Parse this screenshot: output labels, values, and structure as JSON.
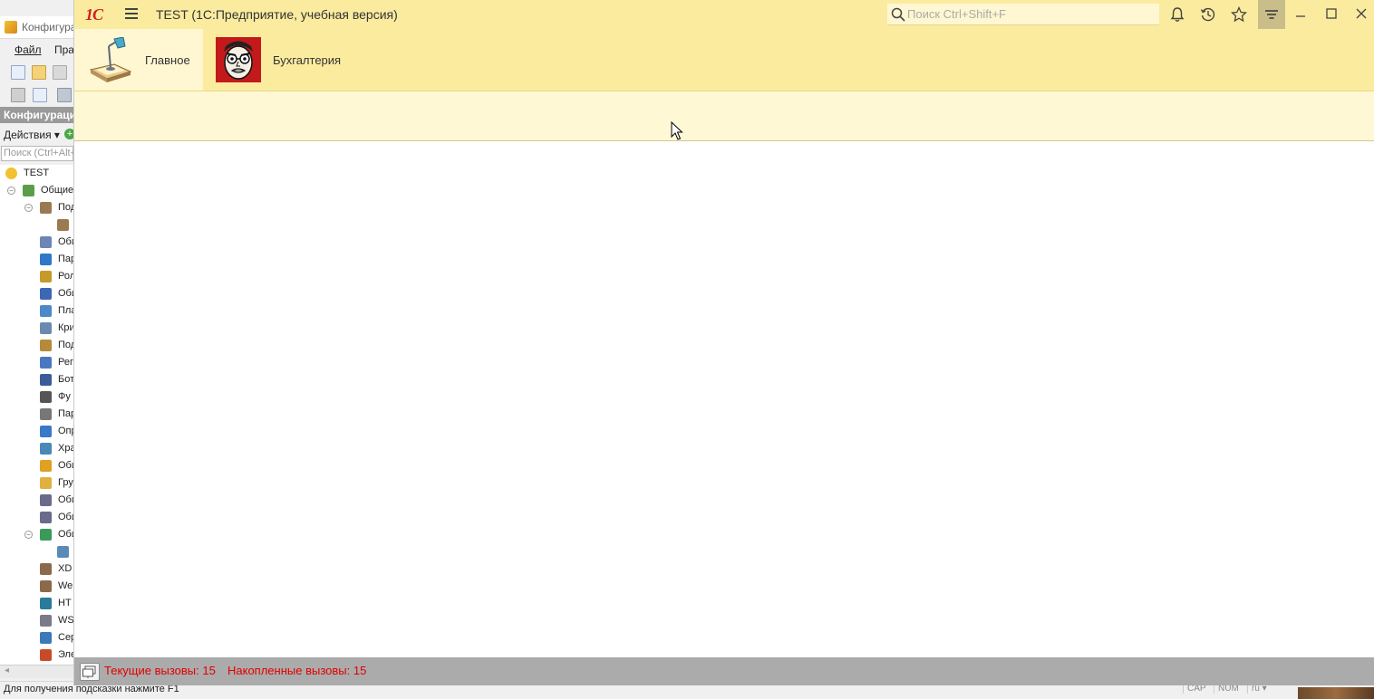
{
  "background_window": {
    "title": "Конфигура",
    "menu": [
      "Файл",
      "Прав"
    ],
    "config_panel_title": "Конфигурация",
    "actions_label": "Действия",
    "actions_plus": "+",
    "search_placeholder": "Поиск (Ctrl+Alt+",
    "tree": [
      {
        "text": "TEST",
        "level": 0,
        "expand": "",
        "icon": "config-icon",
        "color": "#f2c230"
      },
      {
        "text": "Общие",
        "level": 1,
        "expand": "⊖",
        "icon": "common-icon",
        "color": "#5a9e4a"
      },
      {
        "text": "Под",
        "level": 2,
        "expand": "⊖",
        "icon": "subsystems-icon",
        "color": "#9a7a50"
      },
      {
        "text": "",
        "level": 3,
        "expand": "",
        "icon": "subsystem-icon",
        "color": "#9a7a50"
      },
      {
        "text": "Общ",
        "level": 2,
        "expand": "",
        "icon": "common-modules-icon",
        "color": "#6b86b5"
      },
      {
        "text": "Пар",
        "level": 2,
        "expand": "",
        "icon": "session-params-icon",
        "color": "#2e78c8"
      },
      {
        "text": "Рол",
        "level": 2,
        "expand": "",
        "icon": "roles-icon",
        "color": "#c59a2a"
      },
      {
        "text": "Общ",
        "level": 2,
        "expand": "",
        "icon": "common-attributes-icon",
        "color": "#3b67b5"
      },
      {
        "text": "Пла",
        "level": 2,
        "expand": "",
        "icon": "exchange-plans-icon",
        "color": "#4a88c8"
      },
      {
        "text": "Кри",
        "level": 2,
        "expand": "",
        "icon": "filter-criteria-icon",
        "color": "#6a8ab0"
      },
      {
        "text": "Под",
        "level": 2,
        "expand": "",
        "icon": "event-subscriptions-icon",
        "color": "#b58a3a"
      },
      {
        "text": "Рег",
        "level": 2,
        "expand": "",
        "icon": "scheduled-jobs-icon",
        "color": "#4a78c0"
      },
      {
        "text": "Бот",
        "level": 2,
        "expand": "",
        "icon": "bots-icon",
        "color": "#3a5c9a"
      },
      {
        "text": "Фу",
        "level": 2,
        "expand": "",
        "icon": "functional-options-icon",
        "color": "#555555"
      },
      {
        "text": "Пар",
        "level": 2,
        "expand": "",
        "icon": "fo-params-icon",
        "color": "#777777"
      },
      {
        "text": "Опр",
        "level": 2,
        "expand": "",
        "icon": "defined-types-icon",
        "color": "#3a78c8"
      },
      {
        "text": "Хра",
        "level": 2,
        "expand": "",
        "icon": "settings-storage-icon",
        "color": "#4a88b8"
      },
      {
        "text": "Общ",
        "level": 2,
        "expand": "",
        "icon": "common-commands-icon",
        "color": "#e0a020"
      },
      {
        "text": "Гру",
        "level": 2,
        "expand": "",
        "icon": "command-groups-icon",
        "color": "#e0b040"
      },
      {
        "text": "Общ",
        "level": 2,
        "expand": "",
        "icon": "common-forms-icon",
        "color": "#6a6a8a"
      },
      {
        "text": "Общ",
        "level": 2,
        "expand": "",
        "icon": "common-templates-icon",
        "color": "#6a6a8a"
      },
      {
        "text": "Общ",
        "level": 2,
        "expand": "⊖",
        "icon": "common-pictures-icon",
        "color": "#3a9a5a"
      },
      {
        "text": "",
        "level": 3,
        "expand": "",
        "icon": "picture-icon",
        "color": "#5a8ab8"
      },
      {
        "text": "XD",
        "level": 2,
        "expand": "",
        "icon": "xdto-icon",
        "color": "#8a6a4a"
      },
      {
        "text": "We",
        "level": 2,
        "expand": "",
        "icon": "web-services-icon",
        "color": "#8a6a4a"
      },
      {
        "text": "HT",
        "level": 2,
        "expand": "",
        "icon": "http-services-icon",
        "color": "#2a7a9a"
      },
      {
        "text": "WS",
        "level": 2,
        "expand": "",
        "icon": "ws-links-icon",
        "color": "#7a7a8a"
      },
      {
        "text": "Сер",
        "level": 2,
        "expand": "",
        "icon": "integration-services-icon",
        "color": "#3a7ab8"
      },
      {
        "text": "Эле",
        "level": 2,
        "expand": "",
        "icon": "style-items-icon",
        "color": "#c84a2a"
      }
    ],
    "status_hint": "Для получения подсказки нажмите F1",
    "indicators": [
      "CAP",
      "NUM",
      "ru ▾"
    ]
  },
  "app": {
    "logo_text": "1С",
    "title": "TEST  (1С:Предприятие, учебная версия)",
    "search_placeholder": "Поиск Ctrl+Shift+F",
    "sections": [
      {
        "label": "Главное",
        "selected": true
      },
      {
        "label": "Бухгалтерия",
        "selected": false
      }
    ],
    "perf": {
      "current_calls": "Текущие вызовы: 15",
      "accumulated_calls": "Накопленные вызовы: 15"
    },
    "colors": {
      "title_bg": "#fbeb9f",
      "command_panel_bg": "#fff8d5",
      "logo_red": "#d21f1f",
      "perf_text": "#e00000",
      "perf_bar_bg": "#ababab"
    }
  }
}
